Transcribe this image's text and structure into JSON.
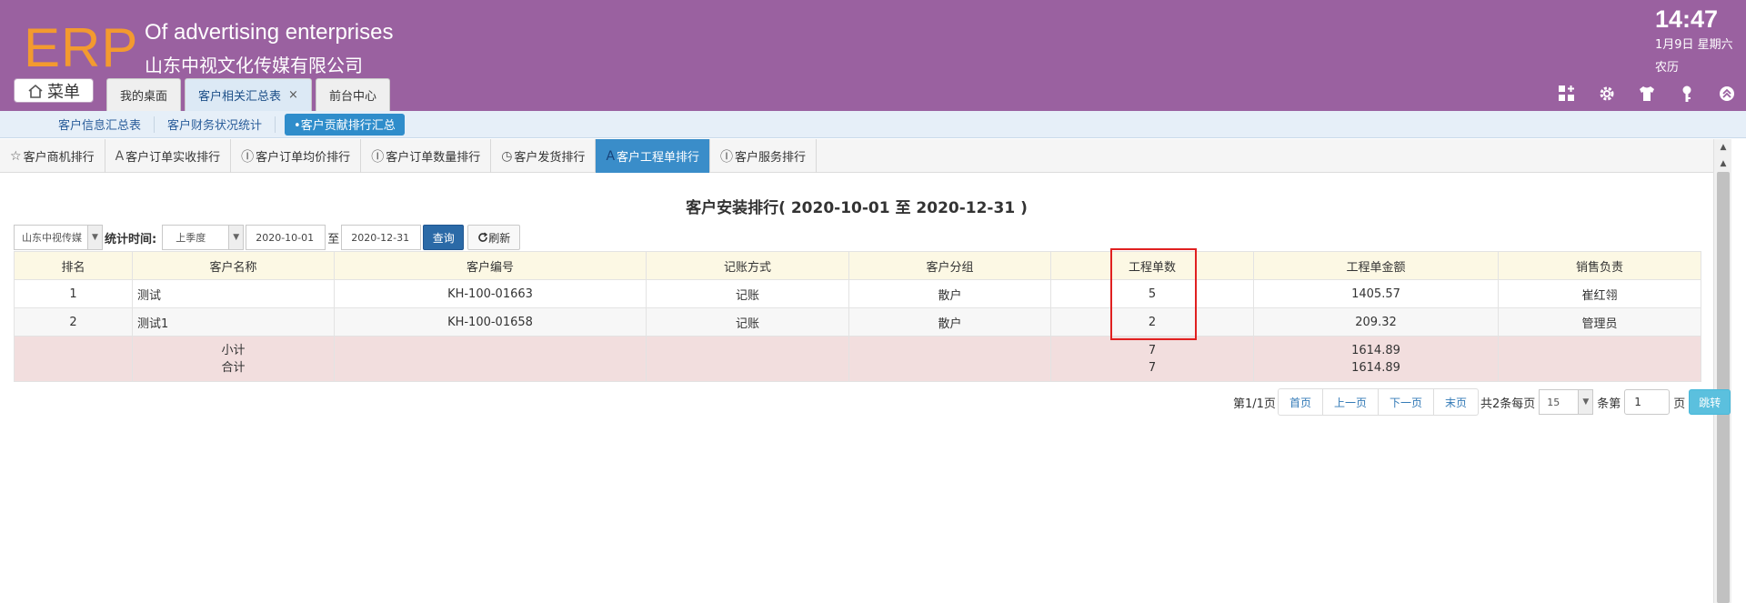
{
  "header": {
    "logo": "ERP",
    "company_en": "Of advertising enterprises",
    "company_cn": "山东中视文化传媒有限公司",
    "time": "14:47",
    "date": "1月9日 星期六",
    "lunar": "农历",
    "menu_label": "菜单",
    "bg_color": "#9a61a0",
    "logo_color": "#f39a2f",
    "icons": [
      "apps-add-icon",
      "gear-icon",
      "shirt-icon",
      "key-icon",
      "collapse-up-icon"
    ]
  },
  "top_tabs": [
    {
      "label": "我的桌面",
      "active": false,
      "closable": false
    },
    {
      "label": "客户相关汇总表",
      "active": true,
      "closable": true,
      "close_glyph": "×"
    },
    {
      "label": "前台中心",
      "active": false,
      "closable": false
    }
  ],
  "sub_nav": [
    {
      "label": "客户信息汇总表",
      "active": false
    },
    {
      "label": "客户财务状况统计",
      "active": false
    },
    {
      "label": "•客户贡献排行汇总",
      "active": true
    }
  ],
  "rank_tabs": [
    {
      "icon": "star-icon",
      "glyph": "☆",
      "label": "客户商机排行",
      "active": false
    },
    {
      "icon": "font-icon",
      "glyph": "A",
      "label": "客户订单实收排行",
      "active": false
    },
    {
      "icon": "pause-circle-icon",
      "glyph": "Ⓘ",
      "label": "客户订单均价排行",
      "active": false
    },
    {
      "icon": "pause-circle-icon",
      "glyph": "Ⓘ",
      "label": "客户订单数量排行",
      "active": false
    },
    {
      "icon": "clock-icon",
      "glyph": "◷",
      "label": "客户发货排行",
      "active": false
    },
    {
      "icon": "font-icon",
      "glyph": "A",
      "label": "客户工程单排行",
      "active": true
    },
    {
      "icon": "pause-circle-icon",
      "glyph": "Ⓘ",
      "label": "客户服务排行",
      "active": false
    }
  ],
  "report": {
    "title": "客户安装排行( 2020-10-01 至 2020-12-31 )"
  },
  "filters": {
    "company_value": "山东中视传媒",
    "period_label": "统计时间:",
    "period_value": "上季度",
    "start_date": "2020-10-01",
    "to_label": "至",
    "end_date": "2020-12-31",
    "query_label": "查询",
    "refresh_label": "刷新"
  },
  "table": {
    "columns": [
      "排名",
      "客户名称",
      "客户编号",
      "记账方式",
      "客户分组",
      "工程单数",
      "工程单金额",
      "销售负责"
    ],
    "rows": [
      {
        "rank": "1",
        "name": "测试",
        "code": "KH-100-01663",
        "billing": "记账",
        "group": "散户",
        "count": "5",
        "amount": "1405.57",
        "sales": "崔红翎"
      },
      {
        "rank": "2",
        "name": "测试1",
        "code": "KH-100-01658",
        "billing": "记账",
        "group": "散户",
        "count": "2",
        "amount": "209.32",
        "sales": "管理员"
      }
    ],
    "subtotal": {
      "label": "小计",
      "count": "7",
      "amount": "1614.89"
    },
    "total": {
      "label": "合计",
      "count": "7",
      "amount": "1614.89"
    }
  },
  "pagination": {
    "page_info": "第1/1页",
    "first": "首页",
    "prev": "上一页",
    "next": "下一页",
    "last": "末页",
    "total_text": "共2条每页",
    "page_size": "15",
    "per_unit": "条第",
    "page_input": "1",
    "page_unit": "页",
    "jump_label": "跳转"
  }
}
